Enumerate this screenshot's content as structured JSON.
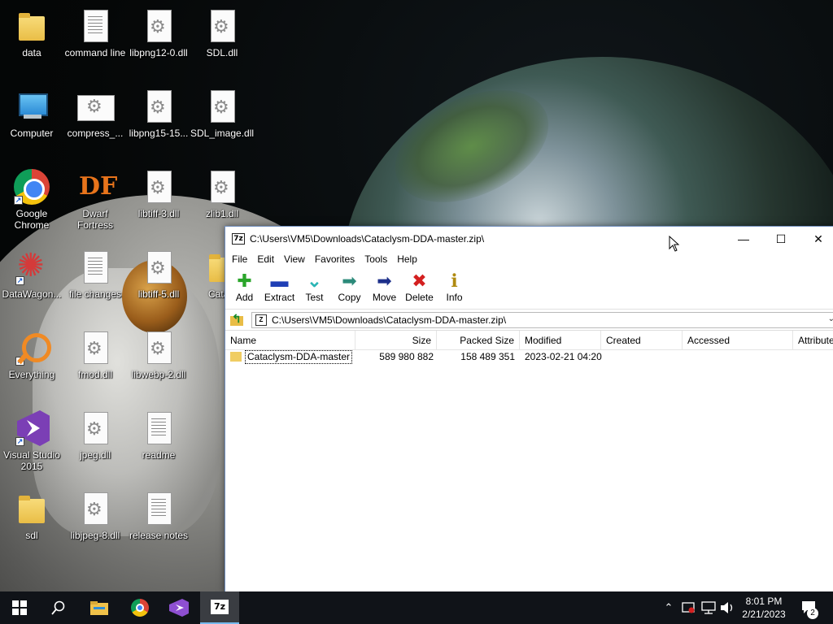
{
  "desktop": {
    "icons": [
      {
        "label": "data",
        "type": "folder"
      },
      {
        "label": "command line",
        "type": "document"
      },
      {
        "label": "libpng12-0.dll",
        "type": "dll"
      },
      {
        "label": "SDL.dll",
        "type": "dll"
      },
      {
        "label": "Computer",
        "type": "computer"
      },
      {
        "label": "compress_...",
        "type": "dll-wide"
      },
      {
        "label": "libpng15-15...",
        "type": "dll"
      },
      {
        "label": "SDL_image.dll",
        "type": "dll"
      },
      {
        "label": "Google Chrome",
        "type": "chrome"
      },
      {
        "label": "Dwarf Fortress",
        "type": "dwarf-fortress"
      },
      {
        "label": "libtiff-3.dll",
        "type": "dll"
      },
      {
        "label": "zlib1.dll",
        "type": "dll"
      },
      {
        "label": "DataWagon...",
        "type": "datawagon"
      },
      {
        "label": "file changes",
        "type": "document"
      },
      {
        "label": "libtiff-5.dll",
        "type": "dll"
      },
      {
        "label": "Catacl",
        "type": "folder"
      },
      {
        "label": "Everything",
        "type": "everything"
      },
      {
        "label": "fmod.dll",
        "type": "dll"
      },
      {
        "label": "libwebp-2.dll",
        "type": "dll"
      },
      {
        "label": "Visual Studio 2015",
        "type": "visual-studio"
      },
      {
        "label": "jpeg.dll",
        "type": "dll"
      },
      {
        "label": "readme",
        "type": "document"
      },
      {
        "label": "sdl",
        "type": "folder"
      },
      {
        "label": "libjpeg-8.dll",
        "type": "dll"
      },
      {
        "label": "release notes",
        "type": "document"
      }
    ]
  },
  "window": {
    "title": "C:\\Users\\VM5\\Downloads\\Cataclysm-DDA-master.zip\\",
    "app_icon_text": "7z",
    "controls": {
      "minimize": "—",
      "maximize": "☐",
      "close": "✕"
    },
    "menu": [
      "File",
      "Edit",
      "View",
      "Favorites",
      "Tools",
      "Help"
    ],
    "toolbar": [
      {
        "label": "Add",
        "glyph": "✚",
        "color": "#2aa52a"
      },
      {
        "label": "Extract",
        "glyph": "▬",
        "color": "#1f3fb5"
      },
      {
        "label": "Test",
        "glyph": "⌄",
        "color": "#2bb5b5"
      },
      {
        "label": "Copy",
        "glyph": "➡",
        "color": "#2c8a7a"
      },
      {
        "label": "Move",
        "glyph": "➡",
        "color": "#1c2f8a"
      },
      {
        "label": "Delete",
        "glyph": "✖",
        "color": "#d42020"
      },
      {
        "label": "Info",
        "glyph": "ℹ",
        "color": "#b08a10"
      }
    ],
    "address": {
      "zip_icon": "Z",
      "path": "C:\\Users\\VM5\\Downloads\\Cataclysm-DDA-master.zip\\",
      "dropdown": "⌄"
    },
    "columns": [
      "Name",
      "Size",
      "Packed Size",
      "Modified",
      "Created",
      "Accessed",
      "Attributes"
    ],
    "rows": [
      {
        "name": "Cataclysm-DDA-master",
        "size": "589 980 882",
        "packed_size": "158 489 351",
        "modified": "2023-02-21 04:20",
        "created": "",
        "accessed": "",
        "attributes": ""
      }
    ]
  },
  "taskbar": {
    "tray_chevron": "⌃",
    "clock_time": "8:01 PM",
    "clock_date": "2/21/2023",
    "notification_count": "2",
    "active_app_label": "7z"
  }
}
